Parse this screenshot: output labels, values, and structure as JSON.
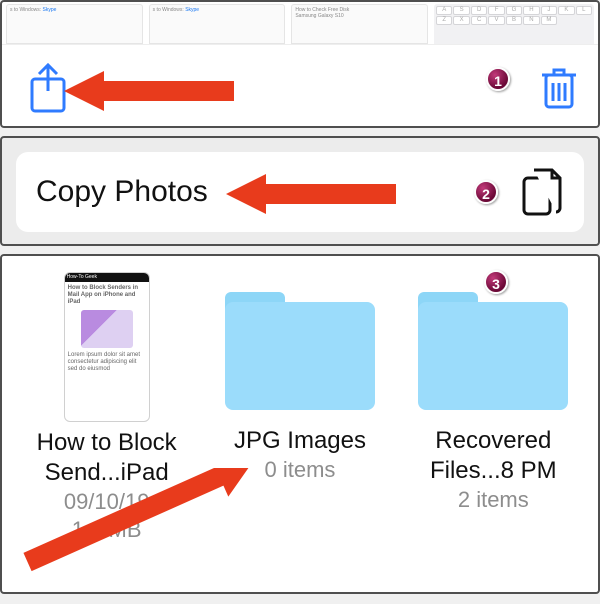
{
  "panel1": {
    "tabs": [
      {
        "snippet": "s to Windows:",
        "link": "Skype"
      },
      {
        "snippet": "s to Windows:",
        "link": "Skype"
      },
      {
        "snippet": "How to Check Free Disk",
        "sub": "Samsung Galaxy S10"
      }
    ],
    "keyboard_keys": [
      "A",
      "S",
      "D",
      "F",
      "G",
      "H",
      "J",
      "K",
      "L",
      "Z",
      "X",
      "C",
      "V",
      "B",
      "N",
      "M"
    ]
  },
  "panel2": {
    "copy_label": "Copy Photos"
  },
  "panel3": {
    "items": [
      {
        "thumb_header": "How-To Geek",
        "thumb_title": "How to Block Senders in Mail App on iPhone and iPad",
        "name": "How to Block Send...iPad",
        "date": "09/10/19",
        "size": "1.3 MB"
      },
      {
        "name": "JPG Images",
        "sub": "0 items"
      },
      {
        "name": "Recovered Files...8 PM",
        "sub": "2 items"
      }
    ]
  },
  "badges": {
    "b1": "1",
    "b2": "2",
    "b3": "3"
  },
  "colors": {
    "ios_blue": "#2f7bff",
    "arrow_red": "#e83b1c",
    "folder": "#9bdcfb"
  }
}
